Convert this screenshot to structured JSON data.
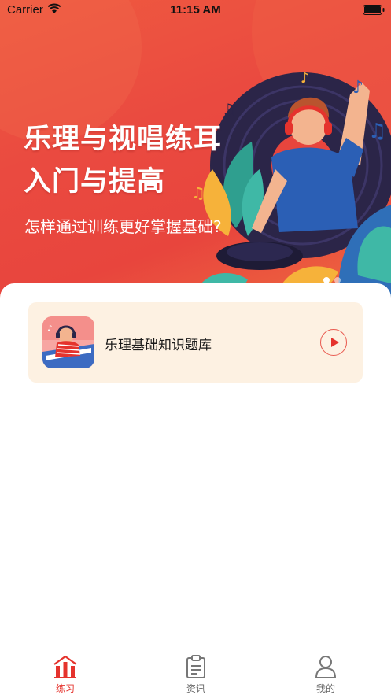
{
  "status_bar": {
    "carrier": "Carrier",
    "time": "11:15 AM",
    "icons": [
      "wifi-icon",
      "battery-icon"
    ]
  },
  "banner": {
    "title_line1": "乐理与视唱练耳",
    "title_line2": "入门与提高",
    "subtitle": "怎样通过训练更好掌握基础?",
    "page_count": 2,
    "active_page": 1
  },
  "course_list": [
    {
      "title": "乐理基础知识题库",
      "icon": "play-icon"
    }
  ],
  "tabbar": {
    "items": [
      {
        "label": "练习",
        "icon": "practice-icon",
        "active": true
      },
      {
        "label": "资讯",
        "icon": "clipboard-icon",
        "active": false
      },
      {
        "label": "我的",
        "icon": "user-icon",
        "active": false
      }
    ]
  },
  "colors": {
    "accent": "#e5332d",
    "banner": "#ea4a40",
    "card_background": "#fdf1e2",
    "tab_inactive": "#666666"
  }
}
